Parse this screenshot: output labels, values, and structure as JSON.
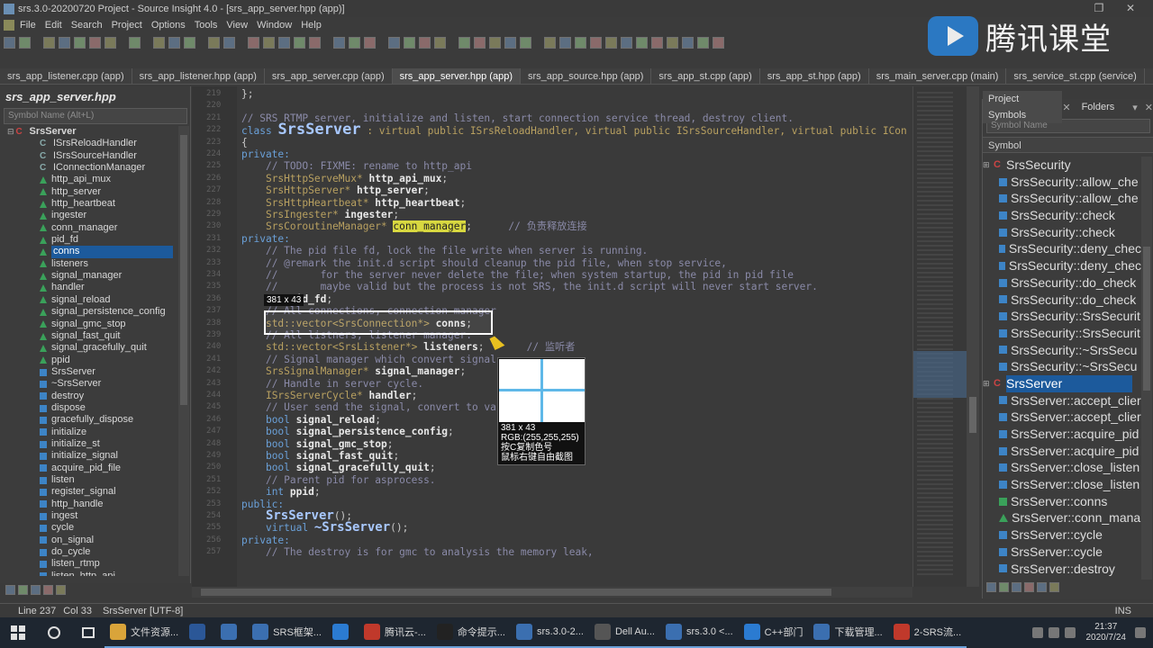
{
  "window": {
    "title": "srs.3.0-20200720 Project - Source Insight 4.0 - [srs_app_server.hpp (app)]"
  },
  "menu": [
    "File",
    "Edit",
    "Search",
    "Project",
    "Options",
    "Tools",
    "View",
    "Window",
    "Help"
  ],
  "watermark": {
    "text": "腾讯课堂"
  },
  "tabs": [
    {
      "label": "srs_app_listener.cpp (app)",
      "active": false
    },
    {
      "label": "srs_app_listener.hpp (app)",
      "active": false
    },
    {
      "label": "srs_app_server.cpp (app)",
      "active": false
    },
    {
      "label": "srs_app_server.hpp (app)",
      "active": true
    },
    {
      "label": "srs_app_source.hpp (app)",
      "active": false
    },
    {
      "label": "srs_app_st.cpp (app)",
      "active": false
    },
    {
      "label": "srs_app_st.hpp (app)",
      "active": false
    },
    {
      "label": "srs_main_server.cpp (main)",
      "active": false
    },
    {
      "label": "srs_service_st.cpp (service)",
      "active": false
    }
  ],
  "left_panel": {
    "title": "srs_app_server.hpp",
    "search_placeholder": "Symbol Name (Alt+L)",
    "tree": [
      {
        "label": "SrsServer",
        "kind": "class",
        "level": 0
      },
      {
        "label": "ISrsReloadHandler",
        "kind": "base",
        "level": 1
      },
      {
        "label": "ISrsSourceHandler",
        "kind": "base",
        "level": 1
      },
      {
        "label": "IConnectionManager",
        "kind": "base",
        "level": 1
      },
      {
        "label": "http_api_mux",
        "kind": "var",
        "level": 1
      },
      {
        "label": "http_server",
        "kind": "var",
        "level": 1
      },
      {
        "label": "http_heartbeat",
        "kind": "var",
        "level": 1
      },
      {
        "label": "ingester",
        "kind": "var",
        "level": 1
      },
      {
        "label": "conn_manager",
        "kind": "var",
        "level": 1
      },
      {
        "label": "pid_fd",
        "kind": "var",
        "level": 1
      },
      {
        "label": "conns",
        "kind": "var",
        "level": 1,
        "selected": true
      },
      {
        "label": "listeners",
        "kind": "var",
        "level": 1
      },
      {
        "label": "signal_manager",
        "kind": "var",
        "level": 1
      },
      {
        "label": "handler",
        "kind": "var",
        "level": 1
      },
      {
        "label": "signal_reload",
        "kind": "var",
        "level": 1
      },
      {
        "label": "signal_persistence_config",
        "kind": "var",
        "level": 1
      },
      {
        "label": "signal_gmc_stop",
        "kind": "var",
        "level": 1
      },
      {
        "label": "signal_fast_quit",
        "kind": "var",
        "level": 1
      },
      {
        "label": "signal_gracefully_quit",
        "kind": "var",
        "level": 1
      },
      {
        "label": "ppid",
        "kind": "var",
        "level": 1
      },
      {
        "label": "SrsServer",
        "kind": "method",
        "level": 1
      },
      {
        "label": "~SrsServer",
        "kind": "method",
        "level": 1
      },
      {
        "label": "destroy",
        "kind": "method",
        "level": 1
      },
      {
        "label": "dispose",
        "kind": "method",
        "level": 1
      },
      {
        "label": "gracefully_dispose",
        "kind": "method",
        "level": 1
      },
      {
        "label": "initialize",
        "kind": "method",
        "level": 1
      },
      {
        "label": "initialize_st",
        "kind": "method",
        "level": 1
      },
      {
        "label": "initialize_signal",
        "kind": "method",
        "level": 1
      },
      {
        "label": "acquire_pid_file",
        "kind": "method",
        "level": 1
      },
      {
        "label": "listen",
        "kind": "method",
        "level": 1
      },
      {
        "label": "register_signal",
        "kind": "method",
        "level": 1
      },
      {
        "label": "http_handle",
        "kind": "method",
        "level": 1
      },
      {
        "label": "ingest",
        "kind": "method",
        "level": 1
      },
      {
        "label": "cycle",
        "kind": "method",
        "level": 1
      },
      {
        "label": "on_signal",
        "kind": "method",
        "level": 1
      },
      {
        "label": "do_cycle",
        "kind": "method",
        "level": 1
      },
      {
        "label": "listen_rtmp",
        "kind": "method",
        "level": 1
      },
      {
        "label": "listen_http_api",
        "kind": "method",
        "level": 1
      }
    ]
  },
  "code": {
    "first_line": 219,
    "lines": [
      {
        "n": "219",
        "html": "<span>};</span>"
      },
      {
        "n": "220",
        "html": ""
      },
      {
        "n": "221",
        "html": "<span class='cm'>// SRS RTMP server, initialize and listen, start connection service thread, destroy client.</span>"
      },
      {
        "n": "222",
        "html": "<span class='k'>class</span> <span class='big'>SrsServer</span> <span class='t'>: virtual public ISrsReloadHandler, virtual public ISrsSourceHandler, virtual public ICon</span>"
      },
      {
        "n": "223",
        "html": "{"
      },
      {
        "n": "224",
        "html": "<span class='k'>private:</span>"
      },
      {
        "n": "225",
        "html": "    <span class='cm'>// TODO: FIXME: rename to http_api</span>"
      },
      {
        "n": "226",
        "html": "    <span class='t'>SrsHttpServeMux*</span> <span class='id'>http_api_mux</span>;"
      },
      {
        "n": "227",
        "html": "    <span class='t'>SrsHttpServer*</span> <span class='id'>http_server</span>;"
      },
      {
        "n": "228",
        "html": "    <span class='t'>SrsHttpHeartbeat*</span> <span class='id'>http_heartbeat</span>;"
      },
      {
        "n": "229",
        "html": "    <span class='t'>SrsIngester*</span> <span class='id'>ingester</span>;"
      },
      {
        "n": "230",
        "html": "    <span class='t'>SrsCoroutineManager*</span> <span class='hl'>conn_manager</span>;      <span class='cm'>// 负责释放连接</span>"
      },
      {
        "n": "231",
        "html": "<span class='k'>private:</span>"
      },
      {
        "n": "232",
        "html": "    <span class='cm'>// The pid file fd, lock the file write when server is running.</span>"
      },
      {
        "n": "233",
        "html": "    <span class='cm'>// @remark the init.d script should cleanup the pid file, when stop service,</span>"
      },
      {
        "n": "234",
        "html": "    <span class='cm'>//       for the server never delete the file; when system startup, the pid in pid file</span>"
      },
      {
        "n": "235",
        "html": "    <span class='cm'>//       maybe valid but the process is not SRS, the init.d script will never start server.</span>"
      },
      {
        "n": "236",
        "html": "    <span class='k'>int</span> <span class='id'>pid_fd</span>;"
      },
      {
        "n": "237",
        "html": "    <span class='cm'>// All connections, connection manager</span>"
      },
      {
        "n": "238",
        "html": "    <span class='t'>std::vector&lt;SrsConnection*&gt;</span> <span class='id'>conns</span>;"
      },
      {
        "n": "239",
        "html": "    <span class='cm'>// All listners, listener manager.</span>"
      },
      {
        "n": "240",
        "html": "    <span class='t'>std::vector&lt;SrsListener*&gt;</span> <span class='id'>listeners</span>;       <span class='cm'>// 监听者</span>"
      },
      {
        "n": "241",
        "html": "    <span class='cm'>// Signal manager which convert signal</span>"
      },
      {
        "n": "242",
        "html": "    <span class='t'>SrsSignalManager*</span> <span class='id'>signal_manager</span>;"
      },
      {
        "n": "243",
        "html": "    <span class='cm'>// Handle in server cycle.</span>"
      },
      {
        "n": "244",
        "html": "    <span class='t'>ISrsServerCycle*</span> <span class='id'>handler</span>;"
      },
      {
        "n": "245",
        "html": "    <span class='cm'>// User send the signal, convert to va</span>"
      },
      {
        "n": "246",
        "html": "    <span class='k'>bool</span> <span class='id'>signal_reload</span>;"
      },
      {
        "n": "247",
        "html": "    <span class='k'>bool</span> <span class='id'>signal_persistence_config</span>;"
      },
      {
        "n": "248",
        "html": "    <span class='k'>bool</span> <span class='id'>signal_gmc_stop</span>;"
      },
      {
        "n": "249",
        "html": "    <span class='k'>bool</span> <span class='id'>signal_fast_quit</span>;"
      },
      {
        "n": "250",
        "html": "    <span class='k'>bool</span> <span class='id'>signal_gracefully_quit</span>;"
      },
      {
        "n": "251",
        "html": "    <span class='cm'>// Parent pid for asprocess.</span>"
      },
      {
        "n": "252",
        "html": "    <span class='k'>int</span> <span class='id'>ppid</span>;"
      },
      {
        "n": "253",
        "html": "<span class='k'>public:</span>"
      },
      {
        "n": "254",
        "html": "    <span class='med'>SrsServer</span>();"
      },
      {
        "n": "255",
        "html": "    <span class='k'>virtual</span> <span class='med'>~SrsServer</span>();"
      },
      {
        "n": "256",
        "html": "<span class='k'>private:</span>"
      },
      {
        "n": "257",
        "html": "    <span class='cm'>// The destroy is for gmc to analysis the memory leak,</span>"
      }
    ]
  },
  "capture": {
    "size_tag": "381 x 43",
    "info": [
      "381 x 43",
      "RGB:(255,255,255)",
      "按C复制色号",
      "鼠标右键自由截图"
    ]
  },
  "right_panel": {
    "tabs": [
      {
        "label": "Project Symbols",
        "active": true
      },
      {
        "label": "Folders",
        "active": false
      }
    ],
    "search_placeholder": "Symbol Name",
    "header": "Symbol",
    "items": [
      {
        "label": "SrsSecurity",
        "kind": "class"
      },
      {
        "label": "SrsSecurity::allow_che",
        "kind": "m"
      },
      {
        "label": "SrsSecurity::allow_che",
        "kind": "m"
      },
      {
        "label": "SrsSecurity::check",
        "kind": "m"
      },
      {
        "label": "SrsSecurity::check",
        "kind": "m"
      },
      {
        "label": "SrsSecurity::deny_chec",
        "kind": "m"
      },
      {
        "label": "SrsSecurity::deny_chec",
        "kind": "m"
      },
      {
        "label": "SrsSecurity::do_check",
        "kind": "m"
      },
      {
        "label": "SrsSecurity::do_check",
        "kind": "m"
      },
      {
        "label": "SrsSecurity::SrsSecurit",
        "kind": "m"
      },
      {
        "label": "SrsSecurity::SrsSecurit",
        "kind": "m"
      },
      {
        "label": "SrsSecurity::~SrsSecu",
        "kind": "m"
      },
      {
        "label": "SrsSecurity::~SrsSecu",
        "kind": "m"
      },
      {
        "label": "SrsServer",
        "kind": "class",
        "selected": true
      },
      {
        "label": "SrsServer::accept_clier",
        "kind": "m"
      },
      {
        "label": "SrsServer::accept_clier",
        "kind": "m"
      },
      {
        "label": "SrsServer::acquire_pid",
        "kind": "m"
      },
      {
        "label": "SrsServer::acquire_pid",
        "kind": "m"
      },
      {
        "label": "SrsServer::close_listen",
        "kind": "m"
      },
      {
        "label": "SrsServer::close_listen",
        "kind": "m"
      },
      {
        "label": "SrsServer::conns",
        "kind": "v"
      },
      {
        "label": "SrsServer::conn_mana",
        "kind": "d"
      },
      {
        "label": "SrsServer::cycle",
        "kind": "m"
      },
      {
        "label": "SrsServer::cycle",
        "kind": "m"
      },
      {
        "label": "SrsServer::destroy",
        "kind": "m"
      }
    ]
  },
  "status": {
    "line": "Line 237",
    "col": "Col 33",
    "symbol": "SrsServer [UTF-8]",
    "mode": "INS"
  },
  "taskbar": {
    "apps": [
      {
        "label": "文件资源...",
        "color": "#d9a43a"
      },
      {
        "label": "",
        "color": "#2b5797"
      },
      {
        "label": "",
        "color": "#3b6fb0"
      },
      {
        "label": "SRS框架...",
        "color": "#3b6fb0"
      },
      {
        "label": "",
        "color": "#2b7bd1"
      },
      {
        "label": "腾讯云-...",
        "color": "#c0392b"
      },
      {
        "label": "命令提示...",
        "color": "#222222"
      },
      {
        "label": "srs.3.0-2...",
        "color": "#3b6fb0"
      },
      {
        "label": "Dell Au...",
        "color": "#555555"
      },
      {
        "label": "srs.3.0 <...",
        "color": "#3b6fb0"
      },
      {
        "label": "C++部门",
        "color": "#2b7bd1"
      },
      {
        "label": "下载管理...",
        "color": "#3b6fb0"
      },
      {
        "label": "2-SRS流...",
        "color": "#c0392b"
      }
    ],
    "time": "21:37",
    "date": "2020/7/24"
  }
}
